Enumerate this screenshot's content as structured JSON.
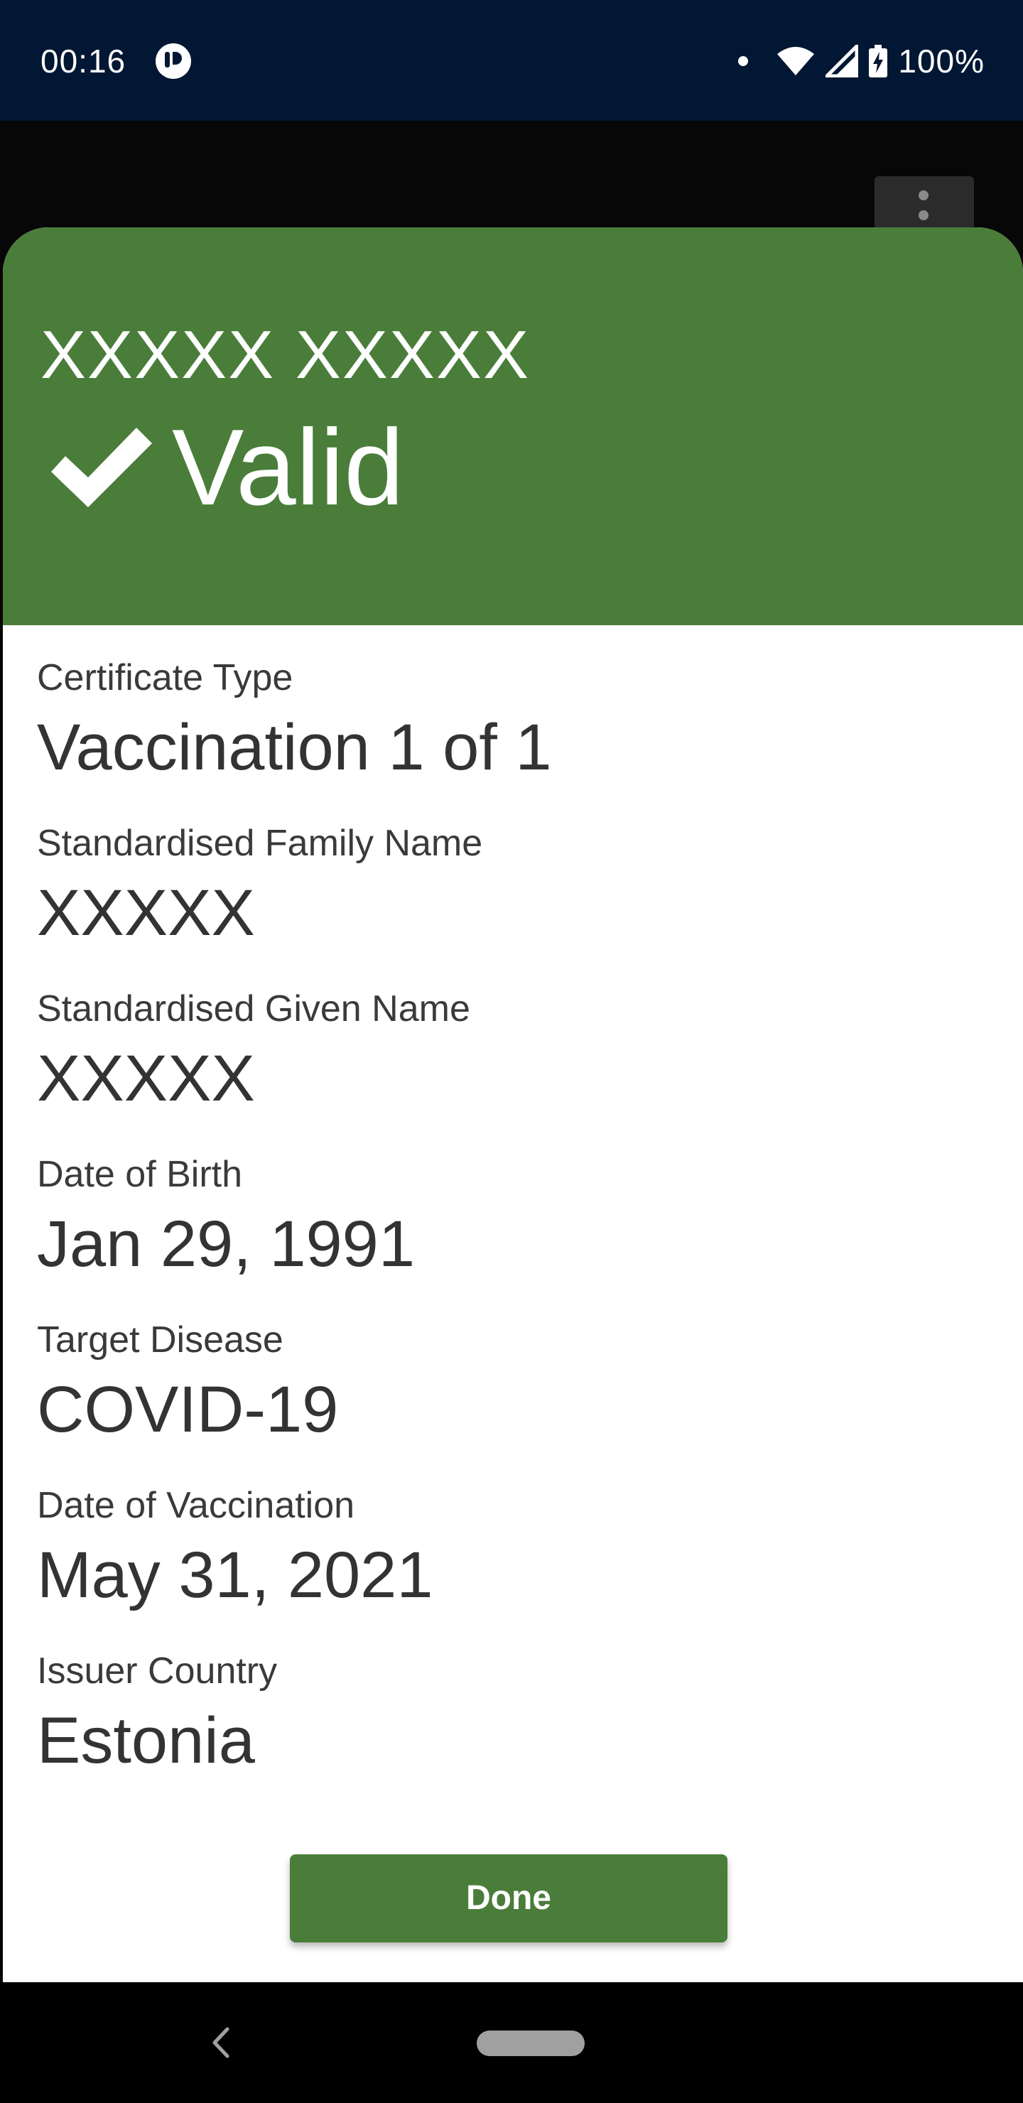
{
  "status_bar": {
    "time": "00:16",
    "battery": "100%",
    "background_color": "#021733",
    "icons": [
      "app-icon",
      "notification-dot-icon",
      "wifi-icon",
      "signal-icon",
      "battery-charging-icon"
    ]
  },
  "background_app": {
    "menu_icon": "more-vert-icon"
  },
  "sheet": {
    "holder_name": "XXXXX XXXXX",
    "status": "Valid",
    "status_icon": "check-icon",
    "status_color": "#4a7d3a",
    "fields": [
      {
        "label": "Certificate Type",
        "value": "Vaccination 1 of 1"
      },
      {
        "label": "Standardised Family Name",
        "value": "XXXXX"
      },
      {
        "label": "Standardised Given Name",
        "value": "XXXXX"
      },
      {
        "label": "Date of Birth",
        "value": "Jan 29, 1991"
      },
      {
        "label": "Target Disease",
        "value": "COVID-19"
      },
      {
        "label": "Date of Vaccination",
        "value": "May 31, 2021"
      },
      {
        "label": "Issuer Country",
        "value": "Estonia"
      }
    ],
    "done_label": "Done"
  },
  "nav_bar": {
    "icons": [
      "back-icon",
      "home-pill-icon"
    ]
  }
}
